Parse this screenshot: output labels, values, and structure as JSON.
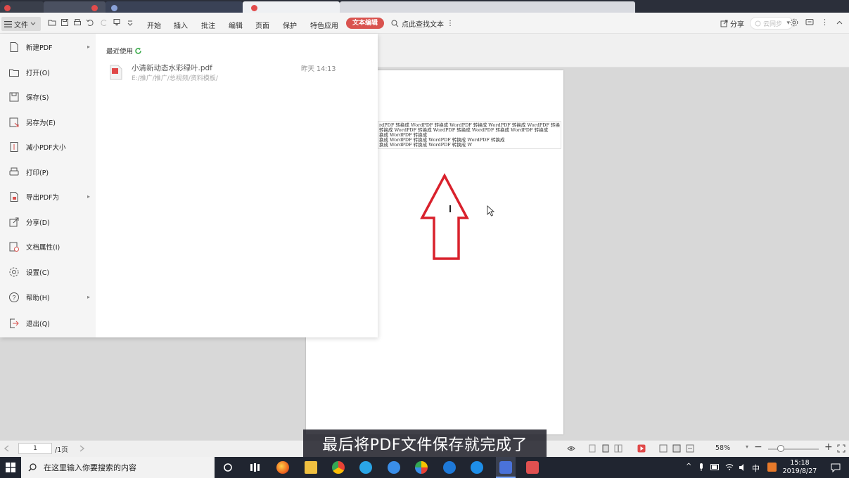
{
  "toolbar": {
    "file_label": "文件",
    "tabs": [
      "开始",
      "插入",
      "批注",
      "编辑",
      "页面",
      "保护",
      "特色应用"
    ],
    "text_edit_label": "文本编辑",
    "search_hint": "点此查找文本",
    "share_label": "分享",
    "sync_label": "云同步"
  },
  "file_menu": {
    "items": [
      {
        "label": "新建PDF",
        "icon": "new-pdf-icon",
        "submenu": true
      },
      {
        "label": "打开(O)",
        "icon": "folder-open-icon",
        "submenu": false
      },
      {
        "label": "保存(S)",
        "icon": "save-icon",
        "submenu": false
      },
      {
        "label": "另存为(E)",
        "icon": "save-as-icon",
        "submenu": false
      },
      {
        "label": "减小PDF大小",
        "icon": "compress-icon",
        "submenu": false
      },
      {
        "label": "打印(P)",
        "icon": "print-icon",
        "submenu": false
      },
      {
        "label": "导出PDF为",
        "icon": "export-icon",
        "submenu": true
      },
      {
        "label": "分享(D)",
        "icon": "share-icon",
        "submenu": false
      },
      {
        "label": "文档属性(I)",
        "icon": "properties-icon",
        "submenu": false
      },
      {
        "label": "设置(C)",
        "icon": "gear-icon",
        "submenu": false
      },
      {
        "label": "帮助(H)",
        "icon": "help-icon",
        "submenu": true
      },
      {
        "label": "退出(Q)",
        "icon": "exit-icon",
        "submenu": false
      }
    ],
    "recent_title": "最近使用",
    "recent_files": [
      {
        "name": "小清新动态水彩绿叶.pdf",
        "path": "E:/推广/推广/总视频/资料模板/",
        "time": "昨天 14:13"
      }
    ]
  },
  "document": {
    "lines": [
      "rdPDF 转换成 WordPDF 转换成 WordPDF 转换成 WordPDF 转换成 WordPDF 转换",
      " 转换成 WordPDF 转换成 WordPDF 转换成 WordPDF 转换成 WordPDF 转换成",
      "换成 WordPDF 转换成",
      "换成 WordPDF 转换成 WordPDF 转换成 WordPDF 转换成",
      "换成 WordPDF 转换成 WordPDF 转换成 W"
    ]
  },
  "statusbar": {
    "page_current": "1",
    "page_total": "/1页",
    "zoom": "58%",
    "zoom_fraction": 0.2
  },
  "subtitle": "最后将PDF文件保存就完成了",
  "taskbar": {
    "search_placeholder": "在这里输入你要搜索的内容",
    "ime": "中",
    "time": "15:18",
    "date": "2019/8/27"
  },
  "colors": {
    "accent": "#d9534f",
    "arrow": "#d9212c",
    "taskbar": "#202530"
  }
}
